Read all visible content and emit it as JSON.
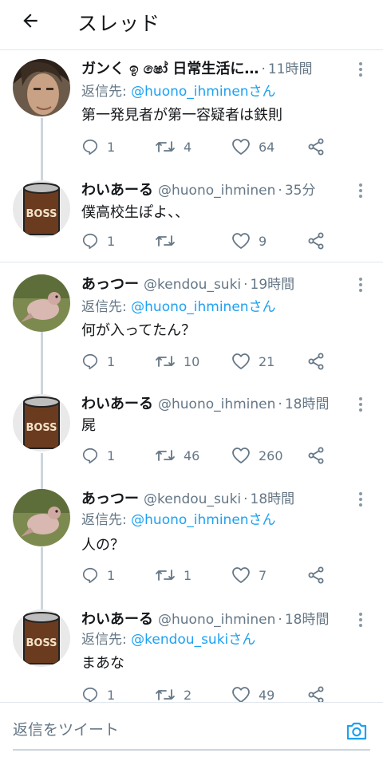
{
  "header": {
    "back_label": "←",
    "title": "スレッド"
  },
  "tweets": [
    {
      "name": "ガンく ඉ ෂෝ 日常生活に…",
      "handle": "",
      "time": "11時間",
      "reply_prefix": "返信先: ",
      "reply_to": "@huono_ihminenさん",
      "text": "第一発見者が第一容疑者は鉄則",
      "replies": "1",
      "retweets": "4",
      "likes": "64"
    },
    {
      "name": "わいあーる",
      "handle": "@huono_ihminen",
      "time": "35分",
      "reply_prefix": "",
      "reply_to": "",
      "text": "僕高校生ぽよ、、",
      "replies": "1",
      "retweets": "",
      "likes": "9"
    },
    {
      "name": "あっつー",
      "handle": "@kendou_suki",
      "time": "19時間",
      "reply_prefix": "返信先: ",
      "reply_to": "@huono_ihminenさん",
      "text": "何が入ってたん？",
      "replies": "1",
      "retweets": "10",
      "likes": "21"
    },
    {
      "name": "わいあーる",
      "handle": "@huono_ihminen",
      "time": "18時間",
      "reply_prefix": "",
      "reply_to": "",
      "text": "屍",
      "replies": "1",
      "retweets": "46",
      "likes": "260"
    },
    {
      "name": "あっつー",
      "handle": "@kendou_suki",
      "time": "18時間",
      "reply_prefix": "返信先: ",
      "reply_to": "@huono_ihminenさん",
      "text": "人の？",
      "replies": "1",
      "retweets": "1",
      "likes": "7"
    },
    {
      "name": "わいあーる",
      "handle": "@huono_ihminen",
      "time": "18時間",
      "reply_prefix": "返信先: ",
      "reply_to": "@kendou_sukiさん",
      "text": "まあな",
      "replies": "1",
      "retweets": "2",
      "likes": "49"
    }
  ],
  "composer": {
    "placeholder": "返信をツイート"
  },
  "colors": {
    "accent": "#1da1f2",
    "secondary_text": "#657786",
    "divider": "#e1e8ed"
  }
}
